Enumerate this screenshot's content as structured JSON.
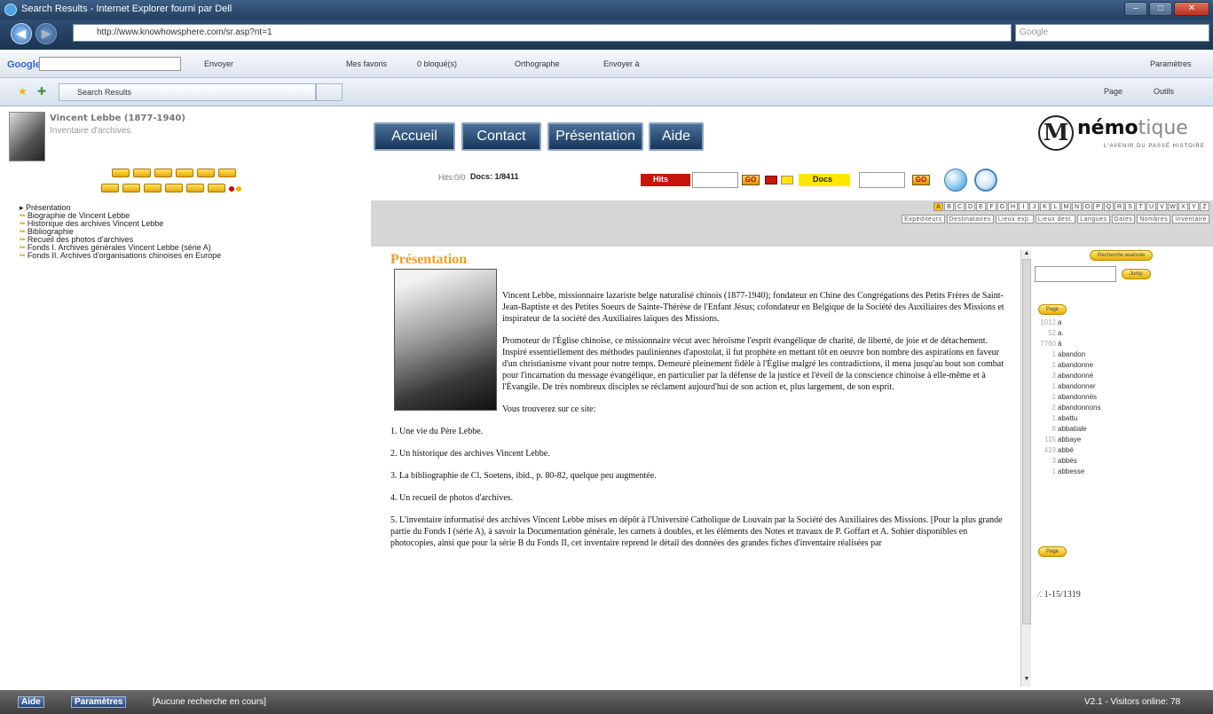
{
  "window": {
    "title": "Search Results - Internet Explorer fourni par Dell",
    "url": "http://www.knowhowsphere.com/sr.asp?nt=1",
    "search_placeholder": "Google"
  },
  "toolbar": {
    "google": "Google",
    "envoyer": "Envoyer",
    "favoris": "Mes favoris",
    "bloques": "0 bloqué(s)",
    "orthographe": "Orthographe",
    "envoyer_a": "Envoyer à",
    "parametres": "Paramètres",
    "tab": "Search Results",
    "page": "Page",
    "outils": "Outils"
  },
  "site": {
    "name": "Vincent Lebbe (1877-1940)",
    "subtitle": "Inventaire d'archives",
    "logo_text": "némo",
    "logo_rest": "tique",
    "logo_tag": "L'AVENIR DU PASSÉ HISTOIRE"
  },
  "header_buttons": [
    "Accueil",
    "Contact",
    "Présentation",
    "Aide"
  ],
  "nav_items": [
    "Présentation",
    "Biographie de Vincent Lebbe",
    "Historique des archives Vincent Lebbe",
    "Bibliographie",
    "Recueil des photos d'archives",
    "Fonds I. Archives générales Vincent Lebbe (série A)",
    "Fonds II. Archives d'organisations chinoises en Europe"
  ],
  "search": {
    "hits_count": "Hits:0/0",
    "docs_count": "Docs: 1/8411",
    "hits": "Hits",
    "docs": "Docs",
    "go": "GO"
  },
  "letters": [
    "A",
    "B",
    "C",
    "D",
    "E",
    "F",
    "G",
    "H",
    "I",
    "J",
    "K",
    "L",
    "M",
    "N",
    "O",
    "P",
    "Q",
    "R",
    "S",
    "T",
    "U",
    "V",
    "W",
    "X",
    "Y",
    "Z"
  ],
  "categories": [
    "Expéditeurs",
    "Destinataires",
    "Lieux exp.",
    "Lieux dest.",
    "Langues",
    "Dates",
    "Nombres",
    "Inventaire"
  ],
  "content": {
    "title": "Présentation",
    "paragraphs": [
      "Vincent Lebbe, missionnaire lazariste belge naturalisé chinois (1877-1940); fondateur en Chine des Congrégations des Petits Frères de Saint-Jean-Baptiste et des Petites Soeurs de Sainte-Thérèse de l'Enfant Jésus; cofondateur en Belgique de la Société des Auxiliaires des Missions et inspirateur de la société des Auxiliaires laïques des Missions.",
      "Promoteur de l'Église chinoise, ce missionnaire vécut avec héroïsme l'esprit évangélique de charité, de liberté, de joie et de détachement. Inspiré essentiellement des méthodes pauliniennes d'apostolat, il fut prophète en mettant tôt en oeuvre bon nombre des aspirations en faveur d'un christianisme vivant pour notre temps. Demeuré pleinement fidèle à l'Église malgré les contradictions, il mena jusqu'au bout son combat pour l'incarnation du message évangélique, en particulier par la défense de la justice et l'éveil de la conscience chinoise à elle-même et à l'Évangile. De très nombreux disciples se réclament aujourd'hui de son action et, plus largement, de son esprit.",
      "Vous trouverez sur ce site:",
      "1. Une vie du Père Lebbe.",
      "2. Un historique des archives Vincent Lebbe.",
      "3. La bibliographie de Cl. Soetens, ibid., p. 80-82, quelque peu augmentée.",
      "4. Un recueil de photos d'archives.",
      "5. L'inventaire informatisé des archives Vincent Lebbe mises en dépôt à l'Université Catholique de Louvain par la Société des Auxiliaires des Missions. [Pour la plus grande partie du Fonds I (série A), à savoir la Documentation générale, les carnets à doubles, et les éléments des Notes et travaux de P. Goffart et A. Sohier disponibles en photocopies, ainsi que pour la série B du Fonds II, cet inventaire reprend le détail des données des grandes fiches d'inventaire réalisées par"
    ]
  },
  "right_panel": {
    "advanced": "Recherche avancée",
    "jump": "Jump",
    "page": "Page",
    "words": [
      [
        "1012",
        "a"
      ],
      [
        "52",
        "a."
      ],
      [
        "7760",
        "à"
      ],
      [
        "1",
        "abandon"
      ],
      [
        "1",
        "abandonne"
      ],
      [
        "3",
        "abandonné"
      ],
      [
        "1",
        "abandonner"
      ],
      [
        "1",
        "abandonnés"
      ],
      [
        "2",
        "abandonnons"
      ],
      [
        "1",
        "abattu"
      ],
      [
        "8",
        "abbatiale"
      ],
      [
        "115",
        "abbaye"
      ],
      [
        "419",
        "abbé"
      ],
      [
        "3",
        "abbés"
      ],
      [
        "1",
        "abbesse"
      ]
    ],
    "range": "1-15/1319"
  },
  "status": {
    "aide": "Aide",
    "parametres": "Paramètres",
    "message": "[Aucune recherche en cours]",
    "version": "V2.1 - Visitors online: 78"
  }
}
